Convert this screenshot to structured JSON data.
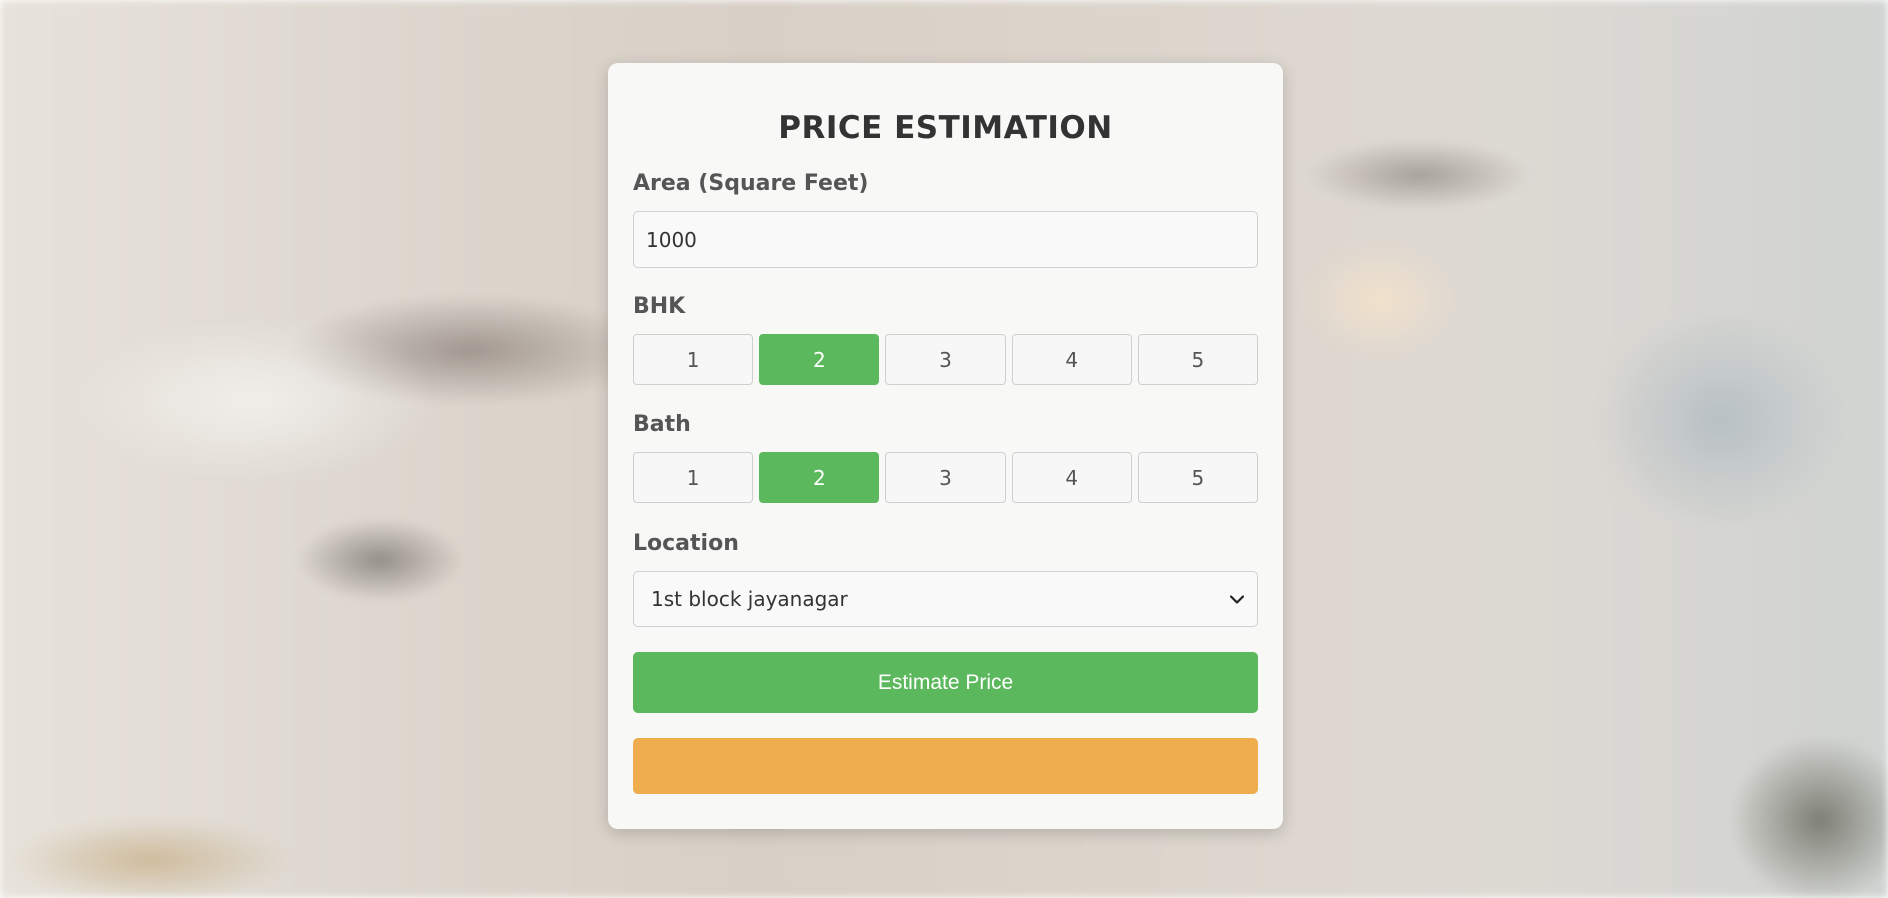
{
  "form": {
    "title": "PRICE ESTIMATION",
    "area": {
      "label": "Area (Square Feet)",
      "value": "1000"
    },
    "bhk": {
      "label": "BHK",
      "options": [
        "1",
        "2",
        "3",
        "4",
        "5"
      ],
      "selected": "2"
    },
    "bath": {
      "label": "Bath",
      "options": [
        "1",
        "2",
        "3",
        "4",
        "5"
      ],
      "selected": "2"
    },
    "location": {
      "label": "Location",
      "selected": "1st block jayanagar",
      "icon": "chevron-down-icon"
    },
    "estimate_button_label": "Estimate Price",
    "result_text": ""
  },
  "colors": {
    "accent_green": "#5cb85c",
    "result_orange": "#f0ad4e",
    "title_text": "#333333",
    "label_text": "#555555"
  }
}
